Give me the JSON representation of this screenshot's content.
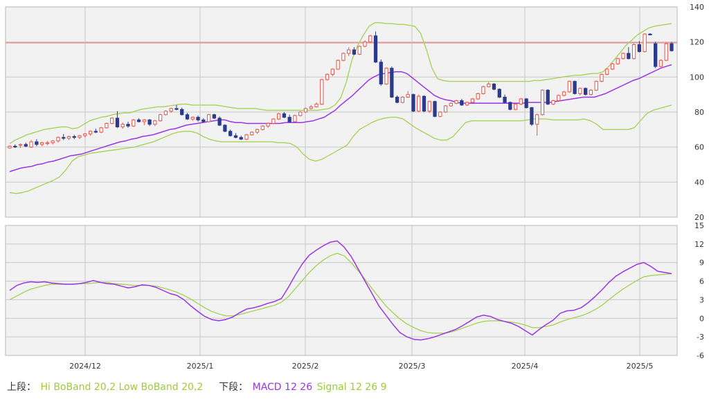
{
  "colors": {
    "candle_up": "#e8534a",
    "candle_down": "#2c3a8c",
    "ma": "#9a34e6",
    "bands": "#a8d35a",
    "ref_line": "#ef8a8a",
    "macd": "#9a34e6",
    "signal": "#a8d35a",
    "panel_bg": "#f2f2f2",
    "grid": "#c8c8c8"
  },
  "legend": {
    "upper_prefix": "上段：",
    "upper_series": "Hi BoBand 20,2 Low BoBand 20,2",
    "lower_prefix": "下段：",
    "lower_series1": "MACD 12 26",
    "lower_series2": "Signal 12 26 9"
  },
  "chart_data": [
    {
      "type": "candlestick",
      "panel": "upper",
      "ylim": [
        20,
        140
      ],
      "yticks": [
        "140",
        "120",
        "100",
        "80",
        "60",
        "40",
        "20"
      ],
      "reference_line": 119.5,
      "x_tick_labels": [
        "2024/12",
        "2025/1",
        "2025/2",
        "2025/3",
        "2025/4",
        "2025/5"
      ],
      "candles": [
        [
          59.5,
          61,
          59,
          60.5
        ],
        [
          60.5,
          61.5,
          59.5,
          60
        ],
        [
          61,
          62,
          59.5,
          61.5
        ],
        [
          61.5,
          62.5,
          60,
          60.5
        ],
        [
          60,
          64,
          59.5,
          63
        ],
        [
          63,
          64.5,
          60.5,
          61.5
        ],
        [
          61.5,
          63,
          60.5,
          62.5
        ],
        [
          62,
          63.5,
          61,
          62.5
        ],
        [
          62.5,
          64,
          61.5,
          63.5
        ],
        [
          63.5,
          66,
          62.5,
          65.5
        ],
        [
          65.5,
          67.5,
          64,
          65
        ],
        [
          65,
          66.5,
          64,
          66
        ],
        [
          66,
          67,
          64.5,
          65.5
        ],
        [
          65.5,
          67,
          64.5,
          66.5
        ],
        [
          66.5,
          68,
          65.5,
          67.5
        ],
        [
          67.5,
          69.5,
          66.5,
          69
        ],
        [
          69,
          70.5,
          68,
          68.5
        ],
        [
          68.5,
          71.5,
          68,
          71
        ],
        [
          71,
          74,
          70.5,
          73.5
        ],
        [
          73.5,
          77,
          73,
          76.5
        ],
        [
          76.5,
          80.5,
          71,
          71.5
        ],
        [
          71.5,
          74,
          70.5,
          73
        ],
        [
          73,
          74.5,
          71,
          72
        ],
        [
          72,
          76,
          71.5,
          75.5
        ],
        [
          75.5,
          76.5,
          74,
          74.5
        ],
        [
          74.5,
          76,
          72.5,
          75.5
        ],
        [
          75.5,
          76,
          72,
          73
        ],
        [
          73,
          75.5,
          72,
          75
        ],
        [
          75,
          79,
          74.5,
          78.5
        ],
        [
          78.5,
          81,
          78,
          80.5
        ],
        [
          80.5,
          82.5,
          79.5,
          82
        ],
        [
          82,
          84,
          81,
          81.5
        ],
        [
          81.5,
          82.5,
          78,
          78.5
        ],
        [
          78.5,
          79.5,
          75.5,
          76
        ],
        [
          76,
          77.5,
          75,
          77
        ],
        [
          77,
          78,
          74.5,
          75.5
        ],
        [
          75.5,
          76.5,
          74,
          74.5
        ],
        [
          74.5,
          79,
          74,
          78.5
        ],
        [
          78.5,
          79,
          76,
          76.5
        ],
        [
          76.5,
          77.5,
          72,
          72.5
        ],
        [
          72.5,
          73,
          68.5,
          69
        ],
        [
          69,
          70,
          66,
          66.5
        ],
        [
          66.5,
          68,
          65,
          65.5
        ],
        [
          65.5,
          66.5,
          64,
          64.5
        ],
        [
          64.5,
          67.5,
          64,
          67
        ],
        [
          67,
          69,
          66.5,
          68.5
        ],
        [
          68.5,
          70.5,
          67.5,
          70
        ],
        [
          70,
          72.5,
          69.5,
          72
        ],
        [
          72,
          74,
          71,
          73.5
        ],
        [
          73.5,
          76.5,
          73,
          76
        ],
        [
          76,
          79.5,
          75.5,
          79
        ],
        [
          79,
          80,
          76.5,
          77
        ],
        [
          77,
          78.5,
          74,
          74.5
        ],
        [
          74.5,
          78.5,
          74,
          78
        ],
        [
          78,
          80.5,
          77.5,
          80
        ],
        [
          80,
          82.5,
          79.5,
          82
        ],
        [
          82,
          84,
          81.5,
          83
        ],
        [
          83,
          85.5,
          82.5,
          84.5
        ],
        [
          84.5,
          99,
          84,
          98.5
        ],
        [
          98.5,
          102,
          98,
          101.5
        ],
        [
          101.5,
          105,
          100.5,
          104.5
        ],
        [
          104.5,
          110,
          104,
          109.5
        ],
        [
          109.5,
          114,
          109,
          113.5
        ],
        [
          113.5,
          117,
          112,
          115.5
        ],
        [
          115.5,
          117,
          112.5,
          113
        ],
        [
          113,
          118,
          112.5,
          117.5
        ],
        [
          117.5,
          121,
          117,
          120
        ],
        [
          120,
          124,
          119.5,
          123.5
        ],
        [
          123.5,
          126,
          108,
          108.5
        ],
        [
          108.5,
          110,
          95,
          96
        ],
        [
          96,
          105.5,
          95.5,
          105
        ],
        [
          105,
          106,
          88,
          88.5
        ],
        [
          88.5,
          89.5,
          85,
          85.5
        ],
        [
          85.5,
          89,
          85,
          88.5
        ],
        [
          88.5,
          92,
          88,
          90
        ],
        [
          90,
          90.5,
          80,
          80.5
        ],
        [
          80.5,
          90,
          80,
          89
        ],
        [
          89,
          89.5,
          80,
          80.5
        ],
        [
          80.5,
          86.5,
          79.5,
          86
        ],
        [
          86,
          86.5,
          77,
          77.5
        ],
        [
          77.5,
          80.5,
          77,
          80
        ],
        [
          80,
          84,
          79.5,
          83.5
        ],
        [
          83.5,
          85.5,
          83,
          85
        ],
        [
          85,
          87,
          84.5,
          86.5
        ],
        [
          86.5,
          87.5,
          83.5,
          84
        ],
        [
          84,
          86,
          83.5,
          85.5
        ],
        [
          85.5,
          88,
          85,
          87.5
        ],
        [
          87.5,
          91,
          87,
          90.5
        ],
        [
          90.5,
          95,
          90,
          94.5
        ],
        [
          94.5,
          97,
          94,
          96
        ],
        [
          96,
          96.5,
          92.5,
          93
        ],
        [
          93,
          93.5,
          88,
          88.5
        ],
        [
          88.5,
          90,
          85,
          85.5
        ],
        [
          85.5,
          86,
          81,
          81.5
        ],
        [
          81.5,
          85,
          81,
          84.5
        ],
        [
          84.5,
          88,
          84,
          87.5
        ],
        [
          87.5,
          88,
          82,
          82.5
        ],
        [
          82.5,
          83,
          72,
          73
        ],
        [
          73,
          79,
          66.5,
          78.5
        ],
        [
          78.5,
          93,
          78,
          92.5
        ],
        [
          92.5,
          93,
          84,
          84.5
        ],
        [
          84.5,
          87,
          84,
          86.5
        ],
        [
          86.5,
          90,
          86,
          89.5
        ],
        [
          89.5,
          92,
          89,
          91.5
        ],
        [
          91.5,
          98,
          91,
          97.5
        ],
        [
          97.5,
          98,
          90,
          90.5
        ],
        [
          90.5,
          94,
          89.5,
          93.5
        ],
        [
          93.5,
          94,
          89.5,
          90
        ],
        [
          90,
          93,
          89.5,
          92.5
        ],
        [
          92.5,
          98,
          92,
          97.5
        ],
        [
          97.5,
          102,
          97,
          101.5
        ],
        [
          101.5,
          105,
          101,
          104.5
        ],
        [
          104.5,
          108,
          104,
          107.5
        ],
        [
          107.5,
          111,
          107,
          110.5
        ],
        [
          110.5,
          114,
          110,
          113.5
        ],
        [
          113.5,
          117,
          110,
          110.5
        ],
        [
          110.5,
          119,
          110,
          118.5
        ],
        [
          118.5,
          120.5,
          114,
          114.5
        ],
        [
          114.5,
          125,
          114,
          124.5
        ],
        [
          124.5,
          125,
          124,
          124
        ],
        [
          119,
          120,
          105,
          106
        ],
        [
          106,
          110,
          105.5,
          109.5
        ],
        [
          109.5,
          119.5,
          109,
          119
        ],
        [
          119,
          120,
          114.5,
          115
        ]
      ],
      "ma20": [
        46,
        47,
        48,
        48.5,
        49,
        50,
        50.5,
        51.5,
        52,
        53,
        54,
        55,
        55.5,
        56,
        57,
        58,
        59,
        60,
        61,
        62,
        63,
        63.5,
        64.5,
        65,
        66,
        66.5,
        67,
        68,
        69,
        70,
        70.5,
        71.5,
        72.5,
        73,
        73.5,
        74,
        74.5,
        75,
        75.5,
        75.5,
        74.5,
        74,
        74,
        73.5,
        73.5,
        73.5,
        73.5,
        73.5,
        73.5,
        73.5,
        74,
        74,
        74,
        74,
        74.5,
        75,
        76,
        77,
        79,
        81,
        84,
        86.5,
        89,
        92,
        95,
        98,
        100,
        101.5,
        102,
        102.5,
        103,
        103,
        102,
        99.5,
        97,
        94.5,
        92,
        89.5,
        88,
        87,
        86.5,
        85.5,
        85,
        85,
        85,
        85,
        85,
        85,
        85,
        85,
        85,
        85,
        85,
        85,
        85.5,
        85.5,
        85.5,
        85.5,
        85.5,
        86,
        86.5,
        87,
        87.5,
        88,
        88.5,
        88.5,
        88.5,
        89.5,
        90.5,
        92,
        93.5,
        95,
        96.5,
        98,
        99,
        100.5,
        102,
        103.5,
        105,
        106,
        107
      ],
      "band_upper": [
        62,
        64,
        65.5,
        67,
        68,
        69,
        70,
        70.5,
        71,
        71.5,
        71.5,
        70.5,
        71,
        73,
        75,
        76,
        77,
        77.5,
        78.5,
        79,
        79.5,
        79.5,
        80.5,
        81.5,
        82,
        82.5,
        83,
        83,
        83.5,
        84,
        84.5,
        84.5,
        84,
        84,
        84,
        84,
        84,
        83.5,
        83,
        82.5,
        82,
        82,
        82,
        82,
        81.5,
        81,
        81,
        81,
        81,
        81,
        81,
        81,
        81,
        81,
        81,
        81.5,
        82,
        84,
        88,
        97,
        110,
        118,
        124,
        129,
        131,
        131,
        130.5,
        130.5,
        130,
        130,
        129.5,
        129,
        125,
        116,
        105,
        99,
        98,
        97.5,
        97.5,
        97.5,
        97.5,
        97.5,
        97.5,
        97.5,
        97.5,
        97.5,
        97.5,
        97.5,
        97.5,
        97.5,
        97.5,
        97.5,
        98,
        98,
        98.5,
        99,
        99.5,
        100,
        100.5,
        101,
        101,
        101.5,
        102,
        102,
        103,
        106,
        110,
        114,
        118,
        121,
        124,
        126,
        128,
        129,
        129.5,
        130,
        130.5
      ],
      "band_lower": [
        34,
        33.5,
        34,
        35,
        36.5,
        38,
        39.5,
        41,
        43,
        47,
        52,
        54.5,
        55.5,
        56.5,
        57,
        57.5,
        58,
        58.5,
        59,
        59.5,
        60,
        61,
        62,
        63,
        64.5,
        66,
        67.5,
        68.5,
        69,
        69,
        68,
        66,
        64.5,
        63.5,
        63,
        63,
        63,
        63,
        63,
        63,
        63,
        63,
        63,
        62.5,
        62.5,
        62,
        60,
        56,
        53,
        52,
        53,
        55,
        57,
        59,
        61,
        66,
        70,
        72,
        74,
        75.5,
        76.5,
        77,
        77,
        76,
        73.5,
        71,
        69,
        67,
        65,
        64,
        64,
        66,
        70,
        74,
        75,
        75,
        75,
        75,
        75,
        75,
        75,
        75,
        75,
        75.5,
        76,
        76,
        76,
        75.5,
        75.5,
        75.5,
        75.5,
        75.5,
        76,
        75,
        73,
        70,
        70,
        70,
        70,
        70,
        71,
        75,
        79,
        81,
        82,
        83,
        84
      ]
    },
    {
      "type": "line",
      "panel": "lower",
      "ylim": [
        -6,
        15
      ],
      "yticks": [
        "15",
        "12",
        "9",
        "6",
        "3",
        "0",
        "-3",
        "-6"
      ],
      "x_tick_labels": [
        "2024/12",
        "2025/1",
        "2025/2",
        "2025/3",
        "2025/4",
        "2025/5"
      ],
      "series": [
        {
          "name": "MACD 12 26",
          "values": [
            4.5,
            5.3,
            5.7,
            5.9,
            5.8,
            5.9,
            5.7,
            5.6,
            5.5,
            5.5,
            5.6,
            5.8,
            6.1,
            5.8,
            5.6,
            5.5,
            5.2,
            4.9,
            5.1,
            5.4,
            5.3,
            5.0,
            4.5,
            4.0,
            3.7,
            3.0,
            2.0,
            1.1,
            0.3,
            -0.2,
            -0.4,
            -0.2,
            0.2,
            0.9,
            1.5,
            1.7,
            2.0,
            2.4,
            2.7,
            3.2,
            5.0,
            7.0,
            8.8,
            10.2,
            11.0,
            11.7,
            12.3,
            12.5,
            11.5,
            10.0,
            8.0,
            6.0,
            4.0,
            2.0,
            0.5,
            -1.0,
            -2.3,
            -3.0,
            -3.4,
            -3.5,
            -3.3,
            -3.0,
            -2.6,
            -2.2,
            -1.8,
            -1.2,
            -0.5,
            0.2,
            0.5,
            0.3,
            -0.2,
            -0.5,
            -0.8,
            -1.3,
            -2.0,
            -2.7,
            -1.8,
            -1.0,
            -0.3,
            0.8,
            1.2,
            1.3,
            1.7,
            2.5,
            3.5,
            4.6,
            5.8,
            6.8,
            7.5,
            8.1,
            8.7,
            9.0,
            8.4,
            7.6,
            7.4,
            7.2
          ]
        },
        {
          "name": "Signal 12 26 9",
          "values": [
            3.0,
            3.6,
            4.2,
            4.7,
            5.0,
            5.3,
            5.5,
            5.5,
            5.5,
            5.5,
            5.6,
            5.6,
            5.7,
            5.8,
            5.8,
            5.6,
            5.5,
            5.4,
            5.3,
            5.3,
            5.3,
            5.2,
            4.9,
            4.6,
            4.2,
            3.7,
            3.1,
            2.4,
            1.7,
            1.1,
            0.7,
            0.4,
            0.4,
            0.6,
            0.9,
            1.2,
            1.5,
            1.8,
            2.1,
            2.6,
            3.5,
            4.8,
            6.1,
            7.4,
            8.5,
            9.4,
            10.1,
            10.5,
            10.1,
            9.0,
            7.7,
            6.3,
            4.8,
            3.4,
            2.0,
            0.9,
            -0.1,
            -0.9,
            -1.5,
            -2.0,
            -2.3,
            -2.4,
            -2.4,
            -2.3,
            -2.0,
            -1.6,
            -1.2,
            -0.8,
            -0.5,
            -0.4,
            -0.4,
            -0.5,
            -0.6,
            -0.8,
            -1.1,
            -1.5,
            -1.5,
            -1.3,
            -1.1,
            -0.6,
            -0.2,
            0.1,
            0.4,
            0.8,
            1.4,
            2.1,
            3.0,
            3.9,
            4.7,
            5.4,
            6.1,
            6.7,
            6.9,
            7.0,
            7.1,
            7.2
          ]
        }
      ]
    }
  ]
}
